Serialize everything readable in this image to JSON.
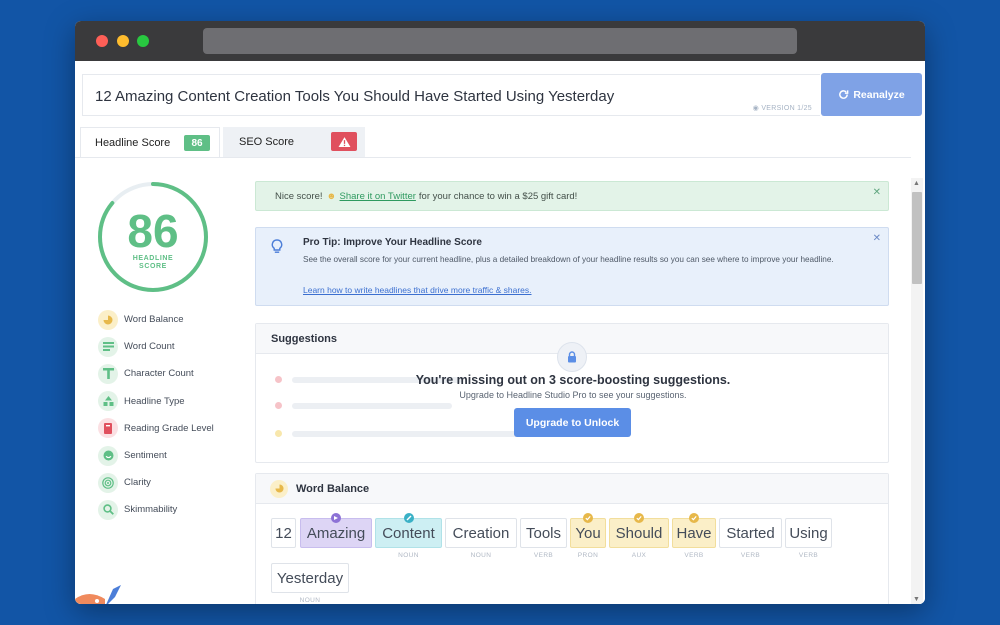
{
  "headline": {
    "text": "12 Amazing Content Creation Tools You Should Have Started Using Yesterday",
    "version": "VERSION 1/25",
    "reanalyze_label": "Reanalyze"
  },
  "tabs": [
    {
      "label": "Headline Score",
      "badge": "86"
    },
    {
      "label": "SEO Score",
      "badge_icon": "warning-icon"
    }
  ],
  "score": {
    "value": "86",
    "label": "HEADLINE SCORE",
    "fraction": 0.86,
    "color": "#5fbf86"
  },
  "sidebar": {
    "items": [
      {
        "label": "Word Balance",
        "icon": "pie-icon"
      },
      {
        "label": "Word Count",
        "icon": "lines-icon"
      },
      {
        "label": "Character Count",
        "icon": "letter-t-icon"
      },
      {
        "label": "Headline Type",
        "icon": "shapes-icon"
      },
      {
        "label": "Reading Grade Level",
        "icon": "book-icon"
      },
      {
        "label": "Sentiment",
        "icon": "smile-icon"
      },
      {
        "label": "Clarity",
        "icon": "target-icon"
      },
      {
        "label": "Skimmability",
        "icon": "magnifier-icon"
      }
    ]
  },
  "banner": {
    "prefix": "Nice score!",
    "link": "Share it on Twitter",
    "suffix": "for your chance to win a $25 gift card!"
  },
  "protip": {
    "title": "Pro Tip: Improve Your Headline Score",
    "body": "See the overall score for your current headline, plus a detailed breakdown of your headline results so you can see where to improve your headline.",
    "link": "Learn how to write headlines that drive more traffic & shares."
  },
  "suggestions": {
    "title": "Suggestions",
    "upsell_title": "You're missing out on 3 score-boosting suggestions.",
    "upsell_sub": "Upgrade to Headline Studio Pro to see your suggestions.",
    "button": "Upgrade to Unlock"
  },
  "word_balance": {
    "title": "Word Balance",
    "words": [
      {
        "word": "12",
        "tag": ""
      },
      {
        "word": "Amazing",
        "tag": "",
        "style": "purple"
      },
      {
        "word": "Content",
        "tag": "NOUN",
        "style": "cyan"
      },
      {
        "word": "Creation",
        "tag": "NOUN"
      },
      {
        "word": "Tools",
        "tag": "VERB"
      },
      {
        "word": "You",
        "tag": "PRON",
        "style": "yellow"
      },
      {
        "word": "Should",
        "tag": "AUX",
        "style": "yellow"
      },
      {
        "word": "Have",
        "tag": "VERB",
        "style": "yellow"
      },
      {
        "word": "Started",
        "tag": "VERB"
      },
      {
        "word": "Using",
        "tag": "VERB"
      },
      {
        "word": "Yesterday",
        "tag": "NOUN"
      }
    ]
  },
  "colors": {
    "background": "#1255a6",
    "accent_green": "#5fbf86",
    "button_blue": "#5b8ee6",
    "reanalyze_blue": "#7fa2e6",
    "warning_red": "#e0505e"
  }
}
